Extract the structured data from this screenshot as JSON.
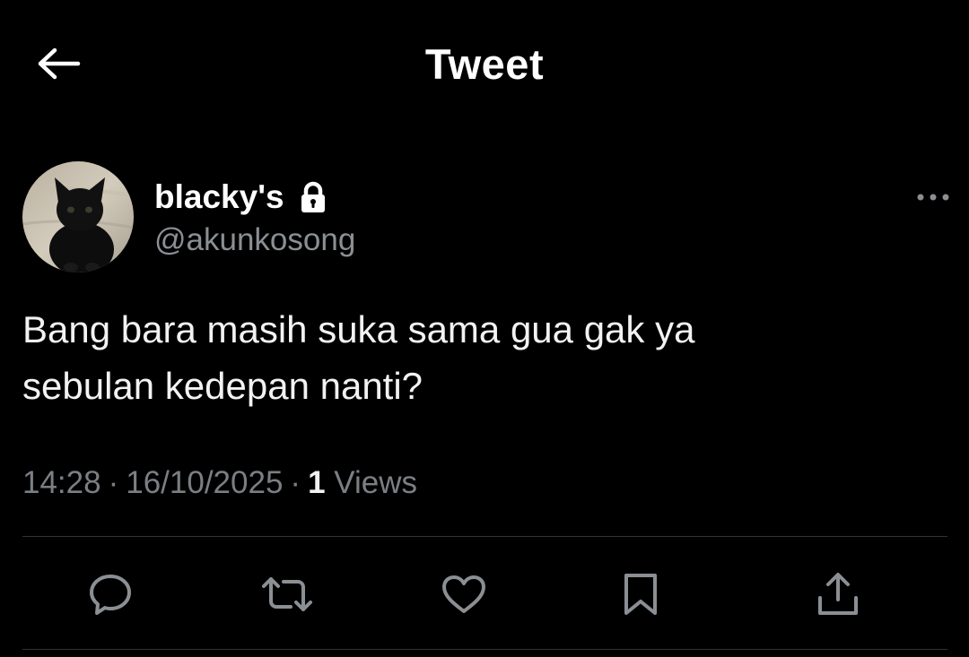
{
  "header": {
    "title": "Tweet",
    "back_icon": "arrow-left-icon"
  },
  "tweet": {
    "author": {
      "display_name": "blacky's",
      "handle": "@akunkosong",
      "protected_icon": "lock-icon",
      "avatar": "black-kitten-photo"
    },
    "text_lines": [
      "Bang bara masih suka sama gua gak ya",
      "sebulan kedepan nanti?"
    ],
    "time": "14:28",
    "date": "16/10/2025",
    "separator": "·",
    "views_count": "1",
    "views_label": "Views"
  },
  "actions": [
    {
      "name": "reply",
      "icon": "reply-bubble-icon"
    },
    {
      "name": "retweet",
      "icon": "retweet-icon"
    },
    {
      "name": "like",
      "icon": "heart-icon"
    },
    {
      "name": "bookmark",
      "icon": "bookmark-icon"
    },
    {
      "name": "share",
      "icon": "share-icon"
    }
  ],
  "colors": {
    "background": "#000000",
    "text_primary": "#ffffff",
    "text_secondary": "#8b8f94",
    "divider": "#2f3336",
    "icon": "#8b8f94"
  }
}
